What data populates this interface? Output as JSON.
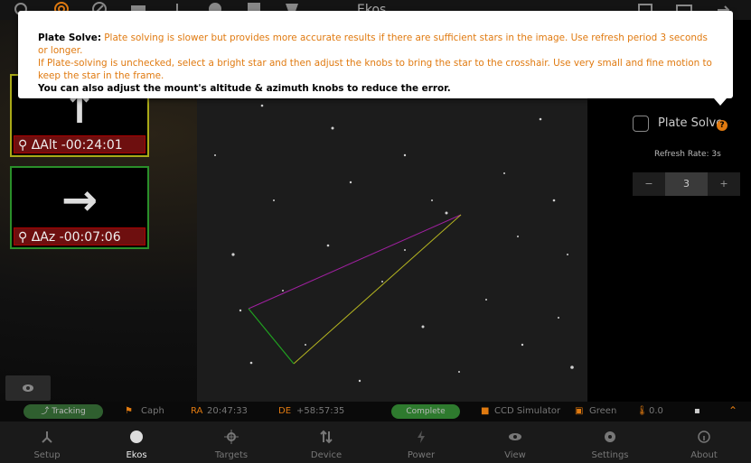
{
  "app": {
    "title": "Ekos"
  },
  "tooltip": {
    "heading": "Plate Solve:",
    "line1": " Plate solving is slower but provides more accurate results if there are sufficient stars in the image. Use refresh period 3 seconds or longer.",
    "line2": "If Plate-solving is unchecked, select a bright star and then adjust the knobs to bring the star to the crosshair. Use very small and fine motion to keep the star in the frame.",
    "line3": "You can also adjust the mount's altitude & azimuth knobs to reduce the error."
  },
  "alignment": {
    "alt": {
      "arrow": "↑",
      "label": "ΔAlt -00:24:01"
    },
    "az": {
      "arrow": "→",
      "label": "ΔAz -00:07:06"
    }
  },
  "panel": {
    "plate_solve_label": "Plate Solve",
    "help": "?",
    "refresh_rate": "Refresh Rate: 3s",
    "minus": "−",
    "value": "3",
    "plus": "+"
  },
  "status": {
    "tracking": "Tracking",
    "target": "Caph",
    "ra_label": "RA",
    "ra_value": "20:47:33",
    "de_label": "DE",
    "de_value": "+58:57:35",
    "state": "Complete",
    "camera": "CCD Simulator",
    "filter": "Green",
    "temp": "0.0"
  },
  "nav": [
    "Setup",
    "Ekos",
    "Targets",
    "Device",
    "Power",
    "View",
    "Settings",
    "About"
  ],
  "colors": {
    "accent": "#e07a10",
    "alert": "#6e0f0f",
    "ok": "#2f5f2f"
  }
}
